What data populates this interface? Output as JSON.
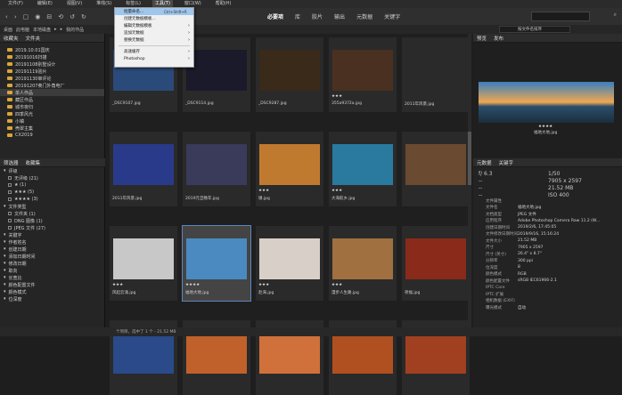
{
  "menubar": {
    "items": [
      "文件(F)",
      "编辑(E)",
      "视图(V)",
      "堆栈(S)",
      "标签(L)",
      "工具(T)",
      "窗口(W)",
      "帮助(H)"
    ]
  },
  "workspaces": [
    "必要项",
    "库",
    "胶片",
    "输出",
    "元数据",
    "关键字"
  ],
  "pathbar": {
    "crumbs": [
      "桌面",
      "此电脑",
      "本地磁盘",
      "▸",
      "▸",
      "我的作品"
    ],
    "sort_label": "按文件名排序"
  },
  "left_tabs": [
    "收藏夹",
    "文件夹"
  ],
  "folders": [
    "2019.10.01国庆",
    "20191016扫描",
    "20191108别墅设计",
    "20191119验片",
    "20191130审评论",
    "20191207奥门外角电厂",
    "单人作品",
    "藏区作品",
    "城市夜归",
    "四季风光",
    "小镇",
    "壳翠主集",
    "CX2019"
  ],
  "filter_tabs": [
    "筛选器",
    "收藏集"
  ],
  "filters": [
    {
      "label": "评级",
      "sub": false
    },
    {
      "label": "无评级 (21)",
      "sub": true
    },
    {
      "label": "★ (1)",
      "sub": true
    },
    {
      "label": "★★★ (5)",
      "sub": true
    },
    {
      "label": "★★★★ (3)",
      "sub": true
    },
    {
      "label": "文件类型",
      "sub": false
    },
    {
      "label": "文件夹 (1)",
      "sub": true
    },
    {
      "label": "DNG 图像 (1)",
      "sub": true
    },
    {
      "label": "JPEG 文件 (27)",
      "sub": true
    },
    {
      "label": "关键字",
      "sub": false
    },
    {
      "label": "作者姓名",
      "sub": false
    },
    {
      "label": "创建日期",
      "sub": false
    },
    {
      "label": "添加日期时间",
      "sub": false
    },
    {
      "label": "修改日期",
      "sub": false
    },
    {
      "label": "取向",
      "sub": false
    },
    {
      "label": "长宽比",
      "sub": false
    },
    {
      "label": "颜色配置文件",
      "sub": false
    },
    {
      "label": "颜色模式",
      "sub": false
    },
    {
      "label": "位深度",
      "sub": false
    }
  ],
  "thumbnails": [
    {
      "cap": "_DSC9107.jpg",
      "stars": "",
      "color": "#2a4a7a"
    },
    {
      "cap": "_DSC9114.jpg",
      "stars": "",
      "color": "#1a1a2a"
    },
    {
      "cap": "_DSC9287.jpg",
      "stars": "",
      "color": "#3a2a1a"
    },
    {
      "cap": "355a9372a.jpg",
      "stars": "★★★",
      "color": "#4a3020"
    },
    {
      "cap": "2011年风景.jpg",
      "stars": "",
      "color": "#2a2a2a"
    },
    {
      "cap": "2011年风景.jpg",
      "stars": "",
      "color": "#2a3a8a"
    },
    {
      "cap": "2019元旦晚年.jpg",
      "stars": "",
      "color": "#3a3a5a"
    },
    {
      "cap": "墩.jpg",
      "stars": "★★★",
      "color": "#c07a30"
    },
    {
      "cap": "大海航乡.jpg",
      "stars": "★★★",
      "color": "#2a7aa0"
    },
    {
      "cap": "",
      "stars": "",
      "color": "#6a4a30"
    },
    {
      "cap": "风起云涌.jpg",
      "stars": "★★★",
      "color": "#c8c8c8"
    },
    {
      "cap": "福地大地.jpg",
      "stars": "★★★★",
      "color": "#4a8ac0"
    },
    {
      "cap": "赴海.jpg",
      "stars": "★★★",
      "color": "#d8d0c8"
    },
    {
      "cap": "漫步人生路.jpg",
      "stars": "★★★",
      "color": "#a07040"
    },
    {
      "cap": "祈福.jpg",
      "stars": "",
      "color": "#8a2a1a"
    },
    {
      "cap": "",
      "stars": "",
      "color": "#2a4a8a"
    },
    {
      "cap": "",
      "stars": "",
      "color": "#c0602a"
    },
    {
      "cap": "",
      "stars": "",
      "color": "#d0703a"
    },
    {
      "cap": "",
      "stars": "",
      "color": "#b05020"
    },
    {
      "cap": "",
      "stars": "",
      "color": "#a04020"
    }
  ],
  "right_tabs": [
    "预览",
    "发布"
  ],
  "preview": {
    "stars": "★★★★",
    "caption": "福地大地.jpg"
  },
  "metadata_tabs": [
    "元数据",
    "关键字"
  ],
  "metadata_summary": [
    {
      "k": "f/ 6.3",
      "v": "1/50"
    },
    {
      "k": "--",
      "v": "7905 x 2597"
    },
    {
      "k": "--",
      "v": "21.52 MB"
    },
    {
      "k": "--",
      "v": "ISO 400"
    }
  ],
  "metadata": [
    {
      "k": "文件属性",
      "v": ""
    },
    {
      "k": "文件名",
      "v": "福地大地.jpg"
    },
    {
      "k": "文档类型",
      "v": "JPEG 文件"
    },
    {
      "k": "应用程序",
      "v": "Adobe Photoshop Camera Raw 11.2 (W..."
    },
    {
      "k": "创建日期时间",
      "v": "2019/2/6, 17:45:05"
    },
    {
      "k": "文件修改日期时间",
      "v": "2019/9/16, 15:16:24"
    },
    {
      "k": "文件大小",
      "v": "21.52 MB"
    },
    {
      "k": "尺寸",
      "v": "7905 x 2597"
    },
    {
      "k": "尺寸 (英寸)",
      "v": "26.4\" x 8.7\""
    },
    {
      "k": "分辨率",
      "v": "300 ppi"
    },
    {
      "k": "位深度",
      "v": "8"
    },
    {
      "k": "颜色模式",
      "v": "RGB"
    },
    {
      "k": "颜色配置文件",
      "v": "sRGB IEC61966-2.1"
    },
    {
      "k": "IPTC Core",
      "v": ""
    },
    {
      "k": "IPTC 扩展",
      "v": ""
    },
    {
      "k": "相机数据 (EXIF)",
      "v": ""
    },
    {
      "k": "曝光模式",
      "v": "自动"
    }
  ],
  "dropdown": {
    "items": [
      {
        "label": "批量命名...",
        "shortcut": "Ctrl+Shift+R",
        "hl": true,
        "arrow": false
      },
      {
        "label": "创建元数据模板...",
        "shortcut": "",
        "hl": false,
        "arrow": false
      },
      {
        "label": "编辑元数据模板",
        "shortcut": "",
        "hl": false,
        "arrow": true
      },
      {
        "label": "追加元数据",
        "shortcut": "",
        "hl": false,
        "arrow": true
      },
      {
        "label": "替换元数据",
        "shortcut": "",
        "hl": false,
        "arrow": true
      },
      {
        "label": "高速缓存",
        "shortcut": "",
        "hl": false,
        "arrow": true
      },
      {
        "label": "Photoshop",
        "shortcut": "",
        "hl": false,
        "arrow": true
      }
    ]
  },
  "status": {
    "text": "个项目，选中了 1 个 - 21.52 MB"
  }
}
